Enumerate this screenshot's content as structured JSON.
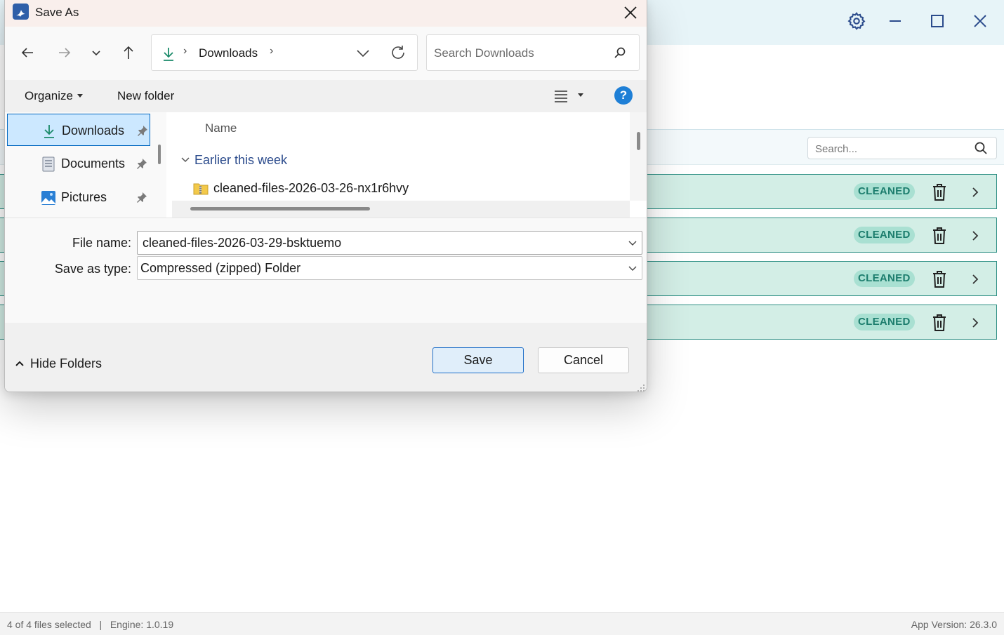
{
  "app": {
    "search_placeholder": "Search...",
    "rows": [
      {
        "status": "CLEANED"
      },
      {
        "status": "CLEANED"
      },
      {
        "status": "CLEANED"
      },
      {
        "status": "CLEANED"
      }
    ],
    "statusbar": {
      "left": "4 of 4 files selected   |   Engine: 1.0.19",
      "right": "App Version: 26.3.0"
    },
    "colors": {
      "titlebar_bg": "#e7f4f8",
      "row_bg": "#d3eee6",
      "row_border": "#2b8e83",
      "badge_bg": "#a9e0d2",
      "badge_text": "#1c7d6d"
    }
  },
  "dialog": {
    "title": "Save As",
    "address": {
      "current_folder": "Downloads",
      "separator": "›"
    },
    "search_placeholder": "Search Downloads",
    "toolbar": {
      "organize": "Organize",
      "new_folder": "New folder",
      "help": "?"
    },
    "nav_pane": [
      {
        "label": "Downloads",
        "icon": "download-arrow-icon",
        "selected": true
      },
      {
        "label": "Documents",
        "icon": "documents-icon",
        "selected": false
      },
      {
        "label": "Pictures",
        "icon": "pictures-icon",
        "selected": false
      }
    ],
    "list": {
      "column_name": "Name",
      "group": "Earlier this week",
      "files": [
        {
          "name": "cleaned-files-2026-03-26-nx1r6hvy",
          "icon": "zip-folder-icon"
        }
      ]
    },
    "form": {
      "file_name_label": "File name:",
      "file_name_value": "cleaned-files-2026-03-29-bsktuemo",
      "save_type_label": "Save as type:",
      "save_type_value": "Compressed (zipped) Folder"
    },
    "footer": {
      "hide_folders": "Hide Folders",
      "save": "Save",
      "cancel": "Cancel"
    },
    "colors": {
      "selected_bg": "#cce8ff",
      "selected_border": "#0067c0",
      "help_bg": "#1e7fd6",
      "accent": "#1e6ec8"
    }
  }
}
